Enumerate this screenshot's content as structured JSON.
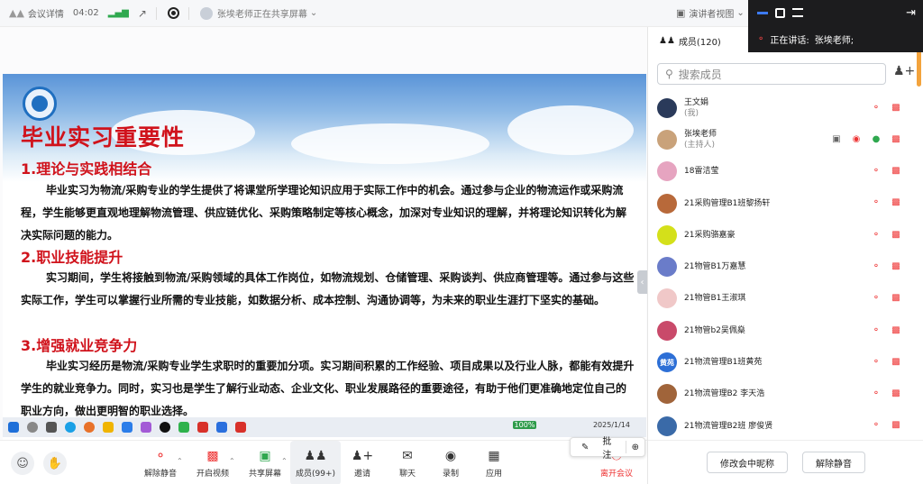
{
  "topbar": {
    "meeting_info": "会议详情",
    "duration": "04:02",
    "sharing_status": "张埃老师正在共享屏幕",
    "presenter_view": "演讲者视图"
  },
  "float": {
    "speaking_label": "正在讲话:",
    "speaker": "张埃老师;"
  },
  "slide": {
    "title": "毕业实习重要性",
    "sections": [
      {
        "heading": "1.理论与实践相结合",
        "text": "毕业实习为物流/采购专业的学生提供了将课堂所学理论知识应用于实际工作中的机会。通过参与企业的物流运作或采购流程，学生能够更直观地理解物流管理、供应链优化、采购策略制定等核心概念，加深对专业知识的理解，并将理论知识转化为解决实际问题的能力。"
      },
      {
        "heading": "2.职业技能提升",
        "text": "实习期间，学生将接触到物流/采购领域的具体工作岗位，如物流规划、仓储管理、采购谈判、供应商管理等。通过参与这些实际工作，学生可以掌握行业所需的专业技能，如数据分析、成本控制、沟通协调等，为未来的职业生涯打下坚实的基础。"
      },
      {
        "heading": "3.增强就业竞争力",
        "text": "毕业实习经历是物流/采购专业学生求职时的重要加分项。实习期间积累的工作经验、项目成果以及行业人脉，都能有效提升学生的就业竞争力。同时，实习也是学生了解行业动态、企业文化、职业发展路径的重要途径，有助于他们更准确地定位自己的职业方向，做出更明智的职业选择。"
      }
    ],
    "taskbar_date": "2025/1/14",
    "battery": "100%"
  },
  "annotation": {
    "label": "批注"
  },
  "toolbar": {
    "unmute": "解除静音",
    "video": "开启视频",
    "share": "共享屏幕",
    "members": "成员(99+)",
    "invite": "邀请",
    "chat": "聊天",
    "record": "录制",
    "apps": "应用",
    "leave": "离开会议"
  },
  "panel": {
    "tab": "成员(120)",
    "search_placeholder": "搜索成员",
    "members": [
      {
        "name": "王文娟",
        "role": "(我)",
        "color": "#2a3a5a",
        "initials": ""
      },
      {
        "name": "张埃老师",
        "role": "(主持人)",
        "color": "#c9a27a",
        "initials": ""
      },
      {
        "name": "18雷洁莹",
        "role": "",
        "color": "#e6a4c0",
        "initials": ""
      },
      {
        "name": "21采购管理B1班黎扬轩",
        "role": "",
        "color": "#b8693a",
        "initials": ""
      },
      {
        "name": "21采购骆嘉豪",
        "role": "",
        "color": "#d4e01a",
        "initials": ""
      },
      {
        "name": "21物管B1万嘉慧",
        "role": "",
        "color": "#6a7cc9",
        "initials": ""
      },
      {
        "name": "21物管B1王淑琪",
        "role": "",
        "color": "#f0c8c8",
        "initials": ""
      },
      {
        "name": "21物管b2吴佩燊",
        "role": "",
        "color": "#c94a6a",
        "initials": ""
      },
      {
        "name": "21物流管理B1班黄苑",
        "role": "",
        "color": "#2d6fd6",
        "initials": "黄苑"
      },
      {
        "name": "21物流管理B2 李天浩",
        "role": "",
        "color": "#a0643a",
        "initials": ""
      },
      {
        "name": "21物流管理B2班 廖俊贤",
        "role": "",
        "color": "#3a6aa8",
        "initials": ""
      }
    ],
    "rename_button": "修改会中昵称",
    "unmute_button": "解除静音"
  }
}
